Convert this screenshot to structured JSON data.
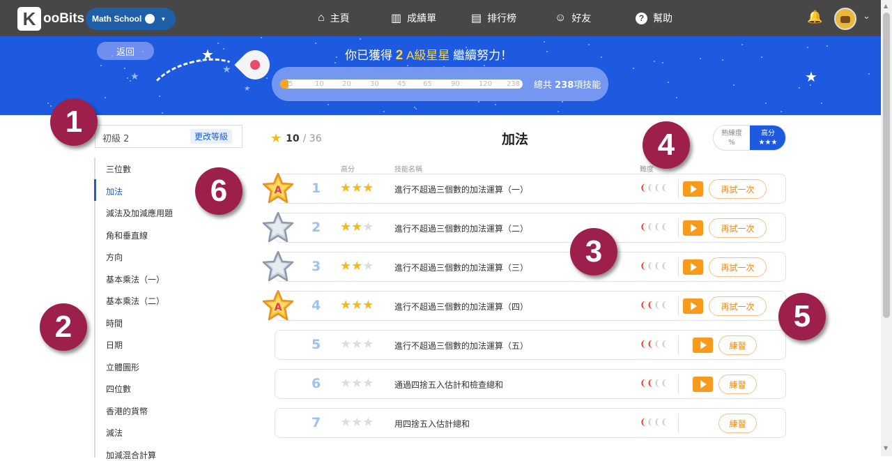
{
  "brand": {
    "logo_k": "K",
    "logo_text": "ooBits",
    "school": "Math School"
  },
  "nav": [
    {
      "label": "主頁",
      "icon": "home-icon",
      "glyph": "⌂"
    },
    {
      "label": "成績單",
      "icon": "bar-chart-icon",
      "glyph": "▥"
    },
    {
      "label": "排行榜",
      "icon": "leaderboard-icon",
      "glyph": "▤"
    },
    {
      "label": "好友",
      "icon": "friends-icon",
      "glyph": "☺"
    },
    {
      "label": "幫助",
      "icon": "help-icon",
      "glyph": "?"
    }
  ],
  "banner": {
    "back_label": "返回",
    "title_pre": "你已獲得",
    "title_num": "2",
    "title_level": "A級星星",
    "title_post": "繼續努力！",
    "progress_ticks": [
      "5",
      "10",
      "20",
      "30",
      "45",
      "65",
      "90",
      "120",
      "238"
    ],
    "progress_fraction": 0.02,
    "total_pre": "總共",
    "total_num": "238",
    "total_post": "項技能"
  },
  "level": {
    "label": "初級 2",
    "change_label": "更改等級"
  },
  "sidebar": {
    "items": [
      "三位數",
      "加法",
      "減法及加減應用題",
      "角和垂直線",
      "方向",
      "基本乘法（一）",
      "基本乘法（二）",
      "時間",
      "日期",
      "立體圖形",
      "四位數",
      "香港的貨幣",
      "減法",
      "加減混合計算"
    ],
    "active_index": 1
  },
  "summary": {
    "stars": "10",
    "total": "/ 36",
    "title": "加法"
  },
  "toggle": {
    "opt1_line1": "熟練度",
    "opt1_line2": "%",
    "opt2_line1": "高分",
    "opt2_line2": "★★★"
  },
  "columns": {
    "score": "高分",
    "name": "技能名稱",
    "difficulty": "難度"
  },
  "skills": [
    {
      "num": "1",
      "name": "進行不超過三個數的加法運算（一）",
      "stars": 3,
      "difficulty": 1,
      "badge": "gold",
      "action": "再試一次",
      "video": true
    },
    {
      "num": "2",
      "name": "進行不超過三個數的加法運算（二）",
      "stars": 2,
      "difficulty": 1,
      "badge": "silver",
      "action": "再試一次",
      "video": true
    },
    {
      "num": "3",
      "name": "進行不超過三個數的加法運算（三）",
      "stars": 2,
      "difficulty": 1,
      "badge": "silver",
      "action": "再試一次",
      "video": true
    },
    {
      "num": "4",
      "name": "進行不超過三個數的加法運算（四）",
      "stars": 3,
      "difficulty": 2,
      "badge": "gold",
      "action": "再試一次",
      "video": true
    },
    {
      "num": "5",
      "name": "進行不超過三個數的加法運算（五）",
      "stars": 0,
      "difficulty": 2,
      "badge": "",
      "action": "練習",
      "video": true
    },
    {
      "num": "6",
      "name": "通過四捨五入估計和檢查總和",
      "stars": 0,
      "difficulty": 2,
      "badge": "",
      "action": "練習",
      "video": true
    },
    {
      "num": "7",
      "name": "用四捨五入估計總和",
      "stars": 0,
      "difficulty": 1,
      "badge": "",
      "action": "練習",
      "video": false
    }
  ],
  "callouts": [
    "1",
    "2",
    "3",
    "4",
    "5",
    "6"
  ],
  "badge_letter": "A",
  "colors": {
    "accent": "#1d5ae0",
    "topbar": "#474747",
    "callout": "#9c1f4c",
    "orange": "#f89a1c",
    "gold": "#f6b91a"
  }
}
